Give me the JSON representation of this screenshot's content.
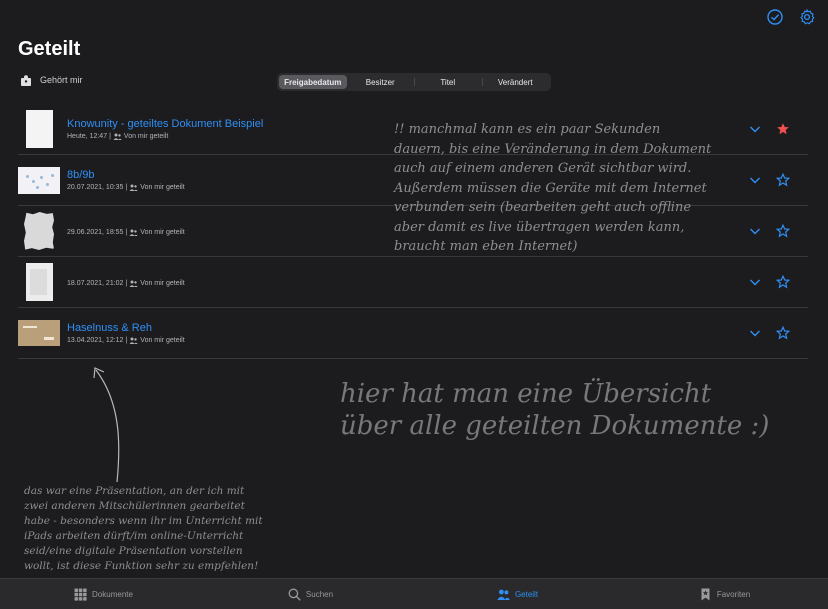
{
  "header": {
    "title": "Geteilt",
    "owner_filter": "Gehört mir"
  },
  "sort_segments": [
    {
      "label": "Freigabedatum",
      "active": true
    },
    {
      "label": "Besitzer",
      "active": false
    },
    {
      "label": "Titel",
      "active": false
    },
    {
      "label": "Verändert",
      "active": false
    }
  ],
  "documents": [
    {
      "title": "Knowunity - geteiltes Dokument Beispiel",
      "date": "Heute, 12:47",
      "shared": "Von mir geteilt",
      "favorite": true
    },
    {
      "title": "8b/9b",
      "date": "20.07.2021, 10:35",
      "shared": "Von mir geteilt",
      "favorite": false
    },
    {
      "title": "",
      "date": "29.06.2021, 18:55",
      "shared": "Von mir geteilt",
      "favorite": false
    },
    {
      "title": "",
      "date": "18.07.2021, 21:02",
      "shared": "Von mir geteilt",
      "favorite": false
    },
    {
      "title": "Haselnuss & Reh",
      "date": "13.04.2021, 12:12",
      "shared": "Von mir geteilt",
      "favorite": false
    }
  ],
  "annotations": {
    "top_note": "!! manchmal kann es ein paar Sekunden dauern, bis eine Veränderung in dem Dokument auch auf einem anderen Gerät sichtbar wird. Außerdem müssen die Geräte mit dem Internet verbunden sein (bearbeiten geht auch offline aber damit es live übertragen werden kann, braucht man eben Internet)",
    "big_note": "hier hat man eine Übersicht über alle geteilten Dokumente :)",
    "small_note": "das war eine Präsentation, an der ich mit zwei anderen Mitschülerinnen gearbeitet habe - besonders wenn ihr im Unterricht mit iPads arbeiten dürft/im online-Unterricht seid/eine digitale Präsentation vorstellen wollt, ist diese Funktion sehr zu empfehlen!"
  },
  "tabbar": {
    "tabs": [
      {
        "label": "Dokumente",
        "icon": "grid-icon",
        "active": false
      },
      {
        "label": "Suchen",
        "icon": "search-icon",
        "active": false
      },
      {
        "label": "Geteilt",
        "icon": "people-icon",
        "active": true
      },
      {
        "label": "Favoriten",
        "icon": "bookmark-icon",
        "active": false
      }
    ]
  },
  "colors": {
    "accent": "#2f8ff4",
    "favorite_star": "#f05050",
    "background": "#1c1c1e"
  }
}
